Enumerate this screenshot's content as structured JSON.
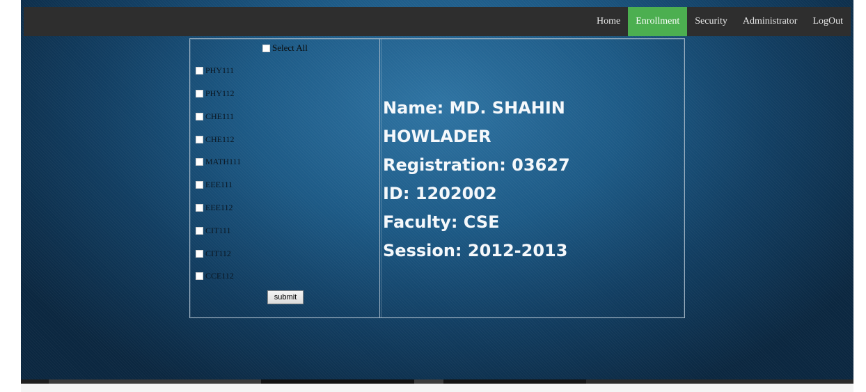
{
  "nav": {
    "items": [
      {
        "label": "Home",
        "active": false
      },
      {
        "label": "Enrollment",
        "active": true
      },
      {
        "label": "Security",
        "active": false
      },
      {
        "label": "Administrator",
        "active": false
      },
      {
        "label": "LogOut",
        "active": false
      }
    ],
    "active_color": "#4caf50",
    "bar_color": "#2e2e2e"
  },
  "enrollment": {
    "select_all_label": "Select All",
    "courses": [
      "PHY111",
      "PHY112",
      "CHE111",
      "CHE112",
      "MATH111",
      "EEE111",
      "EEE112",
      "CIT111",
      "CIT112",
      "CCE112"
    ],
    "submit_label": "submit"
  },
  "student": {
    "name_line1": "Name: MD. SHAHIN",
    "name_line2": "HOWLADER",
    "registration": "Registration: 03627",
    "id": "ID: 1202002",
    "faculty": "Faculty: CSE",
    "session": "Session: 2012-2013"
  }
}
